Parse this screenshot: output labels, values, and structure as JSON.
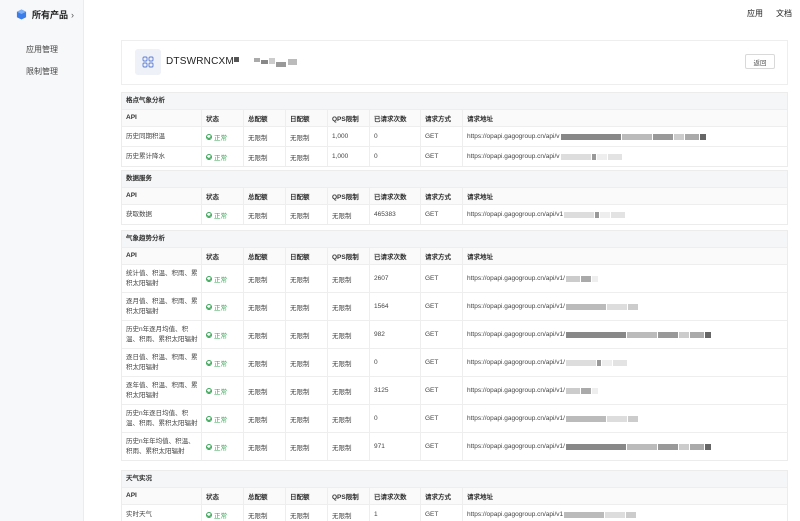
{
  "sidebar": {
    "brand_label": "所有产品",
    "items": [
      {
        "label": "应用管理"
      },
      {
        "label": "限制管理"
      }
    ]
  },
  "topnav": {
    "apps_label": "应用",
    "docs_label": "文档"
  },
  "app_card": {
    "name": "DTSWRNCXM",
    "back_label": "返回"
  },
  "table_headers": {
    "api": "API",
    "status": "状态",
    "total_quota": "总配额",
    "daily_quota": "日配额",
    "qps": "QPS限制",
    "requests": "已请求次数",
    "method": "请求方式",
    "url": "请求地址"
  },
  "sections": [
    {
      "title": "格点气象分析",
      "rows": [
        {
          "api": "历史同期积温",
          "status": "正常",
          "total": "无限制",
          "daily": "无限制",
          "qps": "1,000",
          "count": "0",
          "method": "GET",
          "url": "https://opapi.gagogroup.cn/api/v"
        },
        {
          "api": "历史累计降水",
          "status": "正常",
          "total": "无限制",
          "daily": "无限制",
          "qps": "1,000",
          "count": "0",
          "method": "GET",
          "url": "https://opapi.gagogroup.cn/api/v"
        }
      ]
    },
    {
      "title": "数据服务",
      "rows": [
        {
          "api": "获取数据",
          "status": "正常",
          "total": "无限制",
          "daily": "无限制",
          "qps": "无限制",
          "count": "465383",
          "method": "GET",
          "url": "https://opapi.gagogroup.cn/api/v1"
        }
      ]
    },
    {
      "title": "气象趋势分析",
      "rows": [
        {
          "api": "统计值、积温、积雨、累积太阳辐射",
          "status": "正常",
          "total": "无限制",
          "daily": "无限制",
          "qps": "无限制",
          "count": "2607",
          "method": "GET",
          "url": "https://opapi.gagogroup.cn/api/v1/"
        },
        {
          "api": "逐月值、积温、积雨、累积太阳辐射",
          "status": "正常",
          "total": "无限制",
          "daily": "无限制",
          "qps": "无限制",
          "count": "1564",
          "method": "GET",
          "url": "https://opapi.gagogroup.cn/api/v1/"
        },
        {
          "api": "历史n年逐月均值、积温、积雨、累积太阳辐射",
          "status": "正常",
          "total": "无限制",
          "daily": "无限制",
          "qps": "无限制",
          "count": "982",
          "method": "GET",
          "url": "https://opapi.gagogroup.cn/api/v1/"
        },
        {
          "api": "逐日值、积温、积雨、累积太阳辐射",
          "status": "正常",
          "total": "无限制",
          "daily": "无限制",
          "qps": "无限制",
          "count": "0",
          "method": "GET",
          "url": "https://opapi.gagogroup.cn/api/v1/"
        },
        {
          "api": "逐年值、积温、积雨、累积太阳辐射",
          "status": "正常",
          "total": "无限制",
          "daily": "无限制",
          "qps": "无限制",
          "count": "3125",
          "method": "GET",
          "url": "https://opapi.gagogroup.cn/api/v1/"
        },
        {
          "api": "历史n年逐日均值、积温、积雨、累积太阳辐射",
          "status": "正常",
          "total": "无限制",
          "daily": "无限制",
          "qps": "无限制",
          "count": "0",
          "method": "GET",
          "url": "https://opapi.gagogroup.cn/api/v1/"
        },
        {
          "api": "历史n年年均值、积温、积雨、累积太阳辐射",
          "status": "正常",
          "total": "无限制",
          "daily": "无限制",
          "qps": "无限制",
          "count": "971",
          "method": "GET",
          "url": "https://opapi.gagogroup.cn/api/v1/"
        }
      ]
    },
    {
      "title": "天气实况",
      "rows": [
        {
          "api": "实时天气",
          "status": "正常",
          "total": "无限制",
          "daily": "无限制",
          "qps": "无限制",
          "count": "1",
          "method": "GET",
          "url": "https://opapi.gagogroup.cn/api/v1"
        }
      ]
    }
  ],
  "colors": {
    "status_ok": "#3aa757",
    "section_bg": "#f5f6f8",
    "sidebar_bg": "#f7f8fa"
  }
}
